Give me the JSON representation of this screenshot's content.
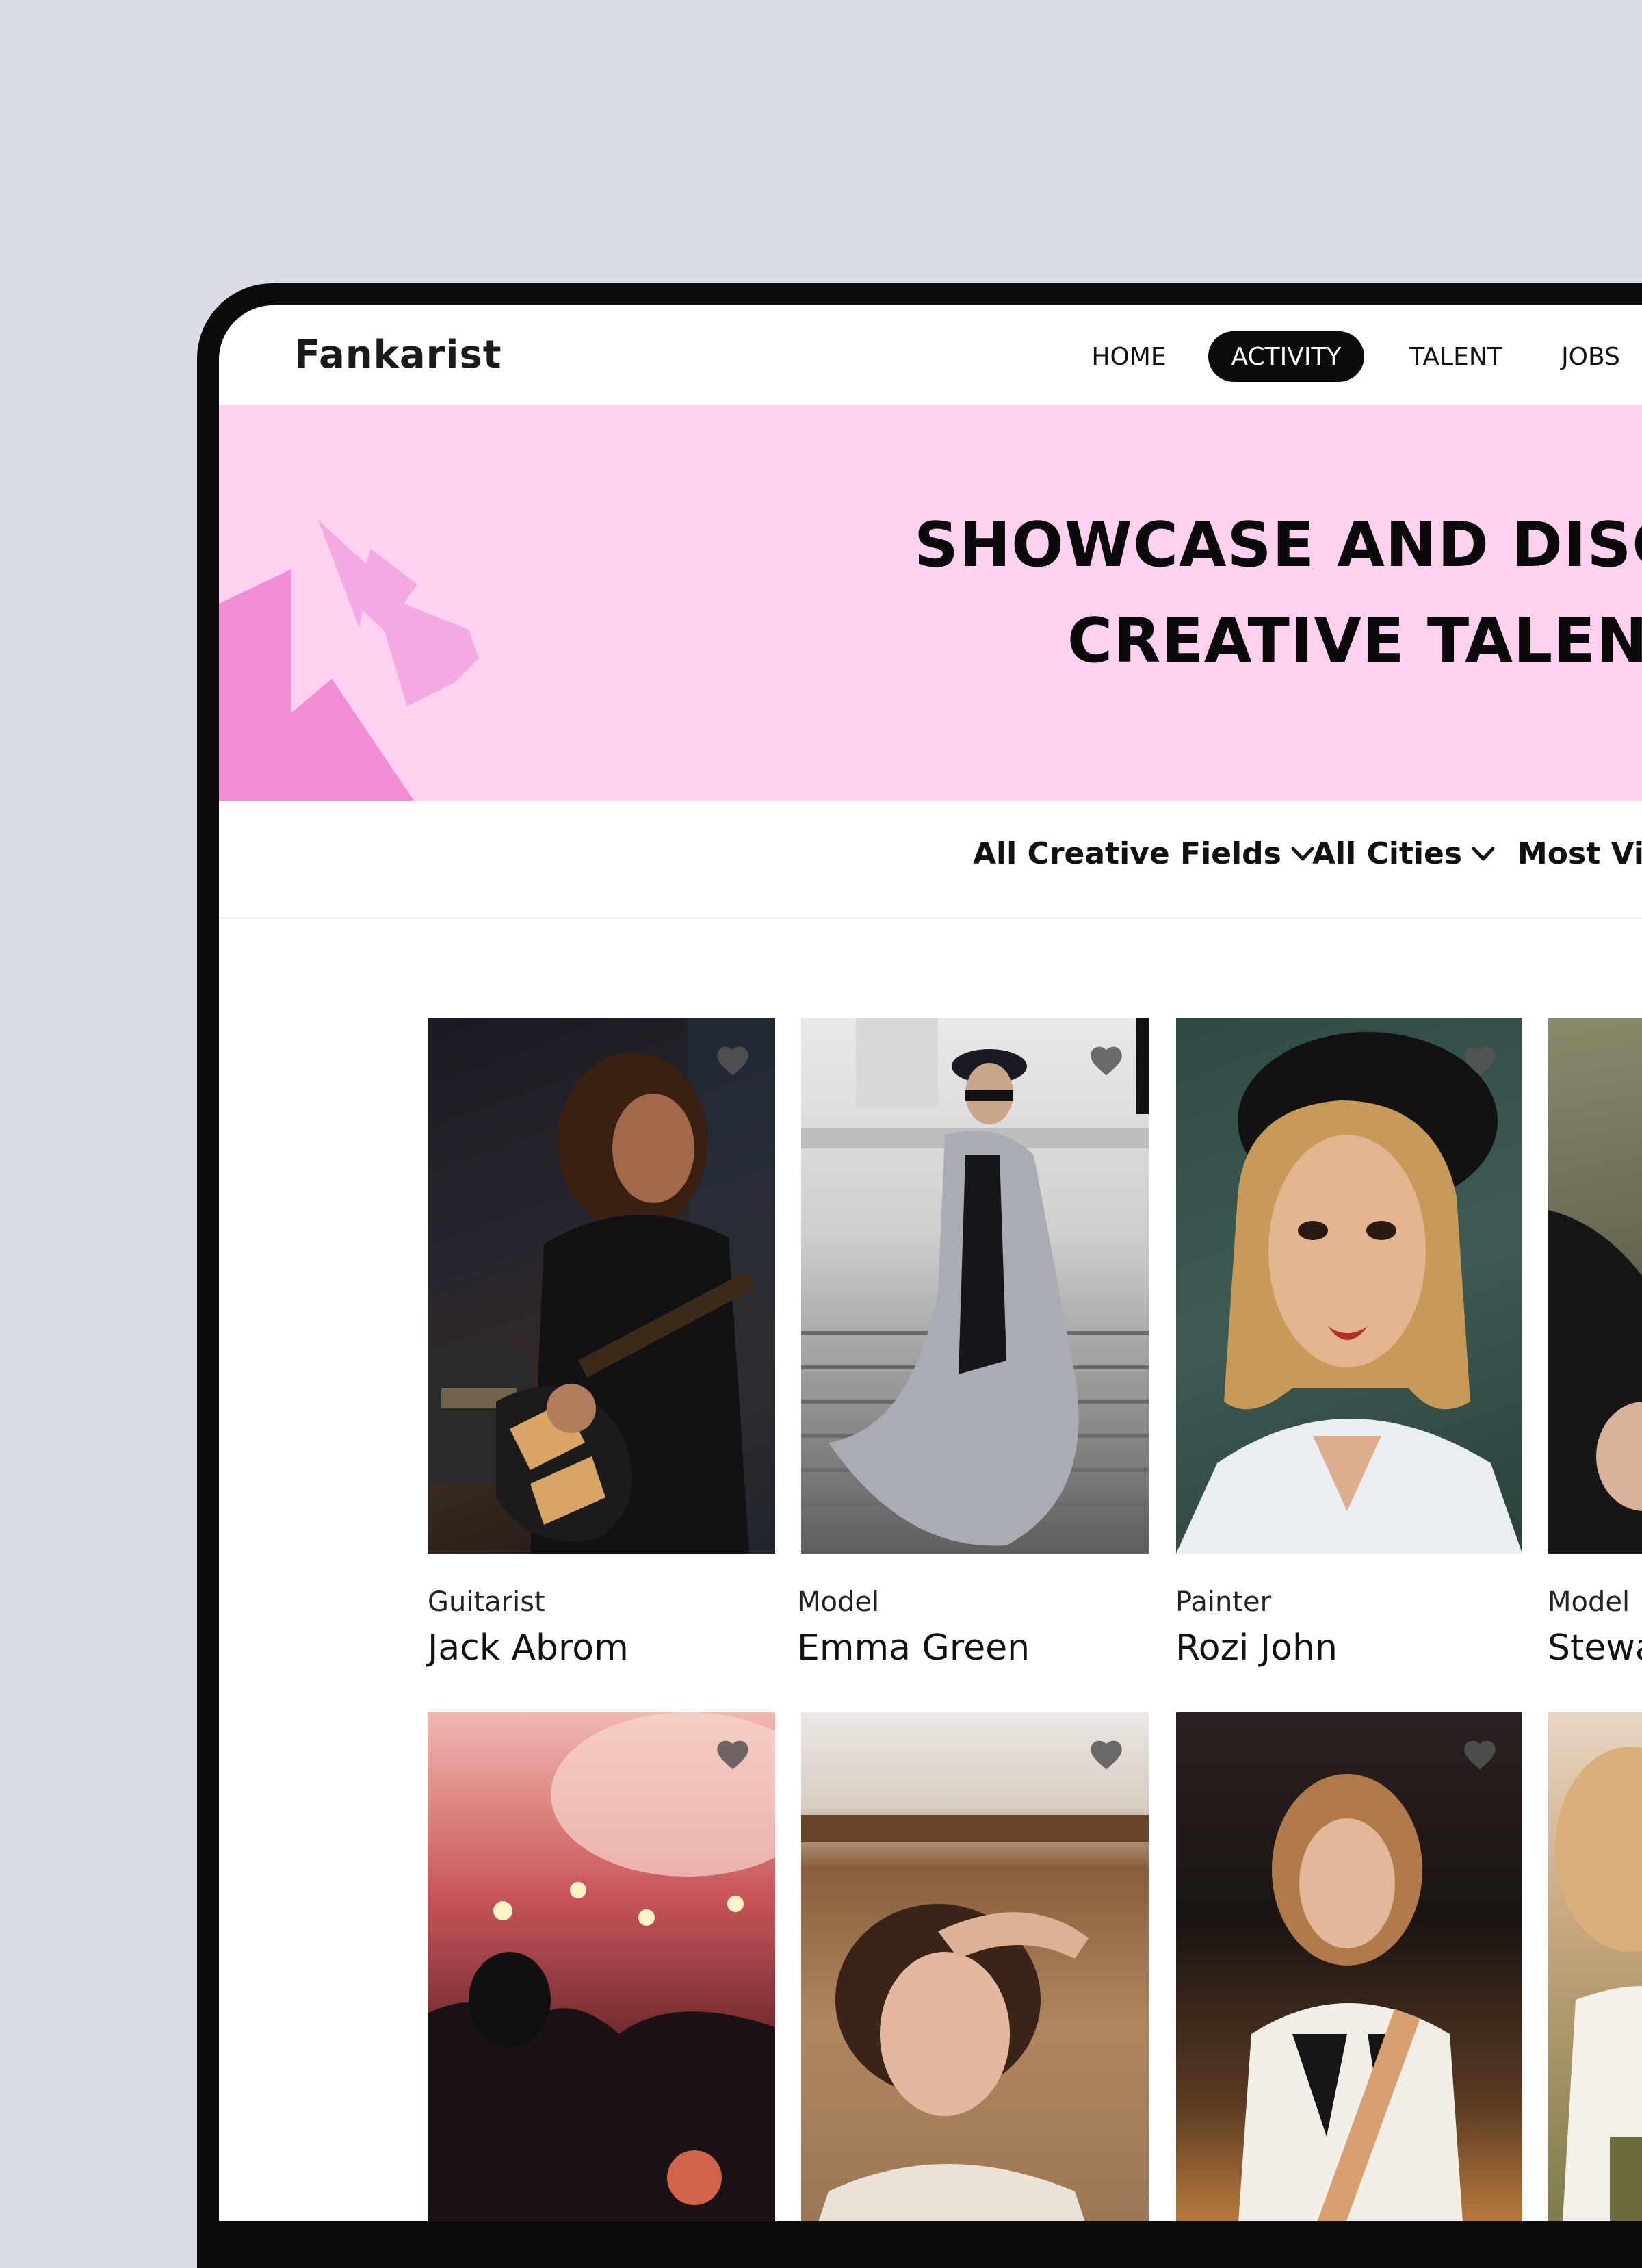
{
  "brand": {
    "logo_text": "Fankarist"
  },
  "nav": {
    "items": [
      {
        "label": "HOME",
        "active": false
      },
      {
        "label": "ACTIVITY",
        "active": true
      },
      {
        "label": "TALENT",
        "active": false
      },
      {
        "label": "JOBS",
        "active": false
      }
    ]
  },
  "hero": {
    "title_line1": "SHOWCASE AND DISCO",
    "title_line2": "CREATIVE TALENT"
  },
  "filters": {
    "creative_fields": "All Creative Fields",
    "cities": "All Cities",
    "sort": "Most Vie"
  },
  "cards": [
    {
      "role": "Guitarist",
      "name": "Jack Abrom",
      "favorite_icon": "heart-icon"
    },
    {
      "role": "Model",
      "name": "Emma Green",
      "favorite_icon": "heart-icon"
    },
    {
      "role": "Painter",
      "name": "Rozi John",
      "favorite_icon": "heart-icon"
    },
    {
      "role": "Model",
      "name": "Stewa",
      "favorite_icon": "heart-icon"
    },
    {
      "favorite_icon": "heart-icon"
    },
    {
      "favorite_icon": "heart-icon"
    },
    {
      "favorite_icon": "heart-icon"
    },
    {}
  ],
  "colors": {
    "page_background": "#dadde6",
    "device_frame": "#0b0b0b",
    "hero_background": "#ffd0ef",
    "hero_shape_dark": "#f08dd6",
    "hero_shape_light": "#f4a9e2",
    "nav_active_background": "#0b0b0b",
    "favorite_icon": "#555555"
  }
}
